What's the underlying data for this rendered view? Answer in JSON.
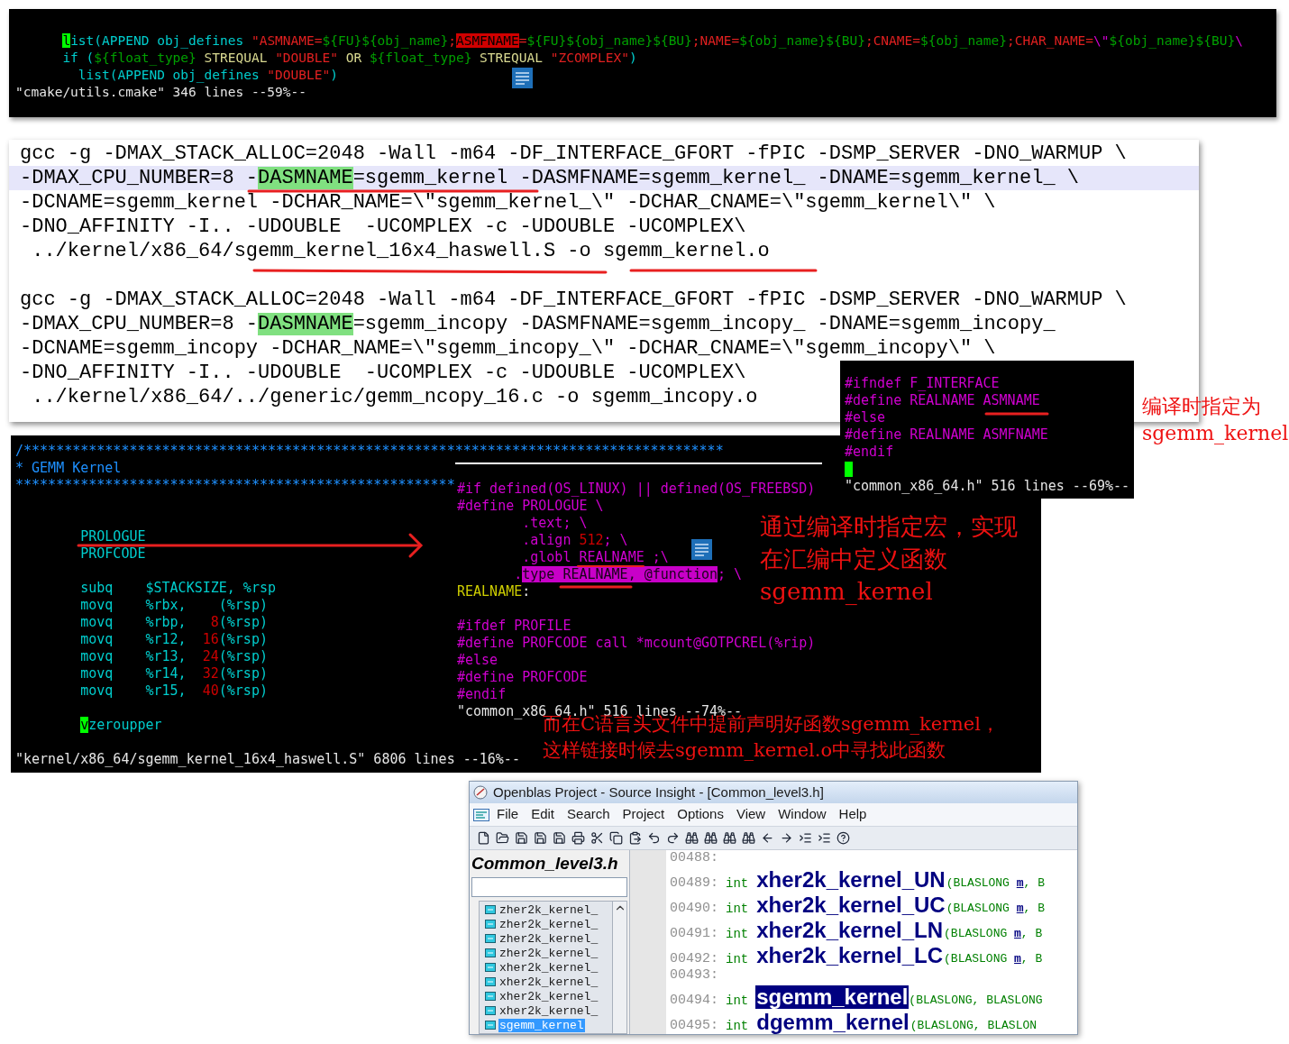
{
  "top_terminal": {
    "lines": [
      [
        {
          "text": "      l",
          "kind": "cursor"
        },
        {
          "text": "ist(APPEND obj_defines ",
          "kind": "keyword"
        },
        {
          "text": "\"ASMNAME=",
          "kind": "string"
        },
        {
          "text": "${FU}${obj_name}",
          "kind": "var"
        },
        {
          "text": ";",
          "kind": "string"
        },
        {
          "text": "ASMFNAME",
          "kind": "search"
        },
        {
          "text": "=",
          "kind": "string"
        },
        {
          "text": "${FU}${obj_name}${BU}",
          "kind": "var"
        },
        {
          "text": ";NAME=",
          "kind": "string"
        },
        {
          "text": "${obj_name}${BU}",
          "kind": "var"
        },
        {
          "text": ";CNAME=",
          "kind": "string"
        },
        {
          "text": "${obj_name}",
          "kind": "var"
        },
        {
          "text": ";CHAR_NAME=",
          "kind": "string"
        },
        {
          "text": "\\\"",
          "kind": "preproc"
        },
        {
          "text": "${obj_name}${BU}",
          "kind": "var"
        },
        {
          "text": "\\",
          "kind": "preproc"
        }
      ],
      [
        {
          "text": "      if (",
          "kind": "keyword"
        },
        {
          "text": "${float_type}",
          "kind": "var"
        },
        {
          "text": " STREQUAL ",
          "kind": "label"
        },
        {
          "text": "\"DOUBLE\"",
          "kind": "string"
        },
        {
          "text": " OR ",
          "kind": "label"
        },
        {
          "text": "${float_type}",
          "kind": "var"
        },
        {
          "text": " STREQUAL ",
          "kind": "label"
        },
        {
          "text": "\"ZCOMPLEX\"",
          "kind": "string"
        },
        {
          "text": ")",
          "kind": "keyword"
        }
      ],
      [
        {
          "text": "        list(APPEND obj_defines ",
          "kind": "keyword"
        },
        {
          "text": "\"DOUBLE\"",
          "kind": "string"
        },
        {
          "text": ")",
          "kind": "keyword"
        }
      ]
    ],
    "status": "\"cmake/utils.cmake\" 346 lines --59%--"
  },
  "build_log": {
    "commands": [
      {
        "lines": [
          {
            "current": false,
            "segments": [
              {
                "text": "gcc -g -DMAX_STACK_ALLOC=2048 -Wall -m64 -DF_INTERFACE_GFORT -fPIC -DSMP_SERVER -DNO_WARMUP \\",
                "kind": "text"
              }
            ]
          },
          {
            "current": true,
            "segments": [
              {
                "text": "-DMAX_CPU_NUMBER=8 -",
                "kind": "text"
              },
              {
                "text": "DASMNAME",
                "kind": "match"
              },
              {
                "text": "=sgemm_kernel -DASMFNAME=sgemm_kernel_ -DNAME=sgemm_kernel_ \\",
                "kind": "text"
              }
            ]
          },
          {
            "current": false,
            "segments": [
              {
                "text": "-DCNAME=sgemm_kernel -DCHAR_NAME=\\\"sgemm_kernel_\\\" -DCHAR_CNAME=\\\"sgemm_kernel\\\" \\",
                "kind": "text"
              }
            ]
          },
          {
            "current": false,
            "segments": [
              {
                "text": "-DNO_AFFINITY -I.. -UDOUBLE  -UCOMPLEX -c -UDOUBLE -UCOMPLEX\\",
                "kind": "text"
              }
            ]
          },
          {
            "current": false,
            "segments": [
              {
                "text": " ../kernel/x86_64/sgemm_kernel_16x4_haswell.S -o sgemm_kernel.o",
                "kind": "text"
              }
            ]
          }
        ]
      },
      {
        "lines": [
          {
            "current": false,
            "segments": [
              {
                "text": "gcc -g -DMAX_STACK_ALLOC=2048 -Wall -m64 -DF_INTERFACE_GFORT -fPIC -DSMP_SERVER -DNO_WARMUP \\",
                "kind": "text"
              }
            ]
          },
          {
            "current": false,
            "segments": [
              {
                "text": "-DMAX_CPU_NUMBER=8 -",
                "kind": "text"
              },
              {
                "text": "DASMNAME",
                "kind": "match"
              },
              {
                "text": "=sgemm_incopy -DASMFNAME=sgemm_incopy_ -DNAME=sgemm_incopy_",
                "kind": "text"
              }
            ]
          },
          {
            "current": false,
            "segments": [
              {
                "text": "-DCNAME=sgemm_incopy -DCHAR_NAME=\\\"sgemm_incopy_\\\" -DCHAR_CNAME=\\\"sgemm_incopy\\\" \\",
                "kind": "text"
              }
            ]
          },
          {
            "current": false,
            "segments": [
              {
                "text": "-DNO_AFFINITY -I.. -UDOUBLE  -UCOMPLEX -c -UDOUBLE -UCOMPLEX\\",
                "kind": "text"
              }
            ]
          },
          {
            "current": false,
            "segments": [
              {
                "text": " ../kernel/x86_64/../generic/gemm_ncopy_16.c -o sgemm_incopy.o",
                "kind": "text"
              }
            ]
          }
        ]
      }
    ]
  },
  "asm_terminal": {
    "blocks": [
      [
        [
          {
            "text": "/**************************************************************************************",
            "kind": "comment"
          }
        ],
        [
          {
            "text": "* GEMM Kernel",
            "kind": "comment"
          }
        ],
        [
          {
            "text": "******************************************************",
            "kind": "comment"
          }
        ]
      ],
      [
        [
          {
            "text": "        PROLOGUE",
            "kind": "keyword"
          }
        ],
        [
          {
            "text": "        PROFCODE",
            "kind": "keyword"
          }
        ]
      ],
      [
        [
          {
            "text": "        subq    $STACKSIZE, %rsp",
            "kind": "keyword"
          }
        ],
        [
          {
            "text": "        movq    %rbx,    (%rsp)",
            "kind": "keyword"
          }
        ],
        [
          {
            "text": "        movq    %rbp,   ",
            "kind": "keyword"
          },
          {
            "text": "8",
            "kind": "number"
          },
          {
            "text": "(%rsp)",
            "kind": "keyword"
          }
        ],
        [
          {
            "text": "        movq    %r12,  ",
            "kind": "keyword"
          },
          {
            "text": "16",
            "kind": "number"
          },
          {
            "text": "(%rsp)",
            "kind": "keyword"
          }
        ],
        [
          {
            "text": "        movq    %r13,  ",
            "kind": "keyword"
          },
          {
            "text": "24",
            "kind": "number"
          },
          {
            "text": "(%rsp)",
            "kind": "keyword"
          }
        ],
        [
          {
            "text": "        movq    %r14,  ",
            "kind": "keyword"
          },
          {
            "text": "32",
            "kind": "number"
          },
          {
            "text": "(%rsp)",
            "kind": "keyword"
          }
        ],
        [
          {
            "text": "        movq    %r15,  ",
            "kind": "keyword"
          },
          {
            "text": "40",
            "kind": "number"
          },
          {
            "text": "(%rsp)",
            "kind": "keyword"
          }
        ]
      ],
      [
        [
          {
            "text": "        v",
            "kind": "cursor"
          },
          {
            "text": "zeroupper",
            "kind": "keyword"
          }
        ]
      ]
    ],
    "status": "\"kernel/x86_64/sgemm_kernel_16x4_haswell.S\" 6806 lines --16%--"
  },
  "macro_terminal": {
    "blocks": [
      [
        [
          {
            "text": "#if defined(OS_LINUX) || defined(OS_FREEBSD)",
            "kind": "preproc"
          }
        ],
        [
          {
            "text": "#define PROLOGUE \\",
            "kind": "preproc"
          }
        ],
        [
          {
            "text": "        .text; \\",
            "kind": "preproc"
          }
        ],
        [
          {
            "text": "        .align ",
            "kind": "preproc"
          },
          {
            "text": "512",
            "kind": "number"
          },
          {
            "text": "; \\",
            "kind": "preproc"
          }
        ],
        [
          {
            "text": "        .globl REALNAME ;\\",
            "kind": "preproc"
          }
        ],
        [
          {
            "text": "       .",
            "kind": "preproc"
          },
          {
            "text": "type REALNAME, @function",
            "kind": "marked"
          },
          {
            "text": "; \\",
            "kind": "preproc"
          }
        ],
        [
          {
            "text": "REALNAME",
            "kind": "ident"
          },
          {
            "text": ":",
            "kind": "plain"
          }
        ]
      ],
      [
        [
          {
            "text": "#ifdef PROFILE",
            "kind": "preproc"
          }
        ],
        [
          {
            "text": "#define PROFCODE call *mcount@GOTPCREL(%rip)",
            "kind": "preproc"
          }
        ],
        [
          {
            "text": "#else",
            "kind": "preproc"
          }
        ],
        [
          {
            "text": "#define PROFCODE",
            "kind": "preproc"
          }
        ],
        [
          {
            "text": "#endif",
            "kind": "preproc"
          }
        ]
      ]
    ],
    "status": "\"common_x86_64.h\" 516 lines --74%--"
  },
  "header_terminal": {
    "lines": [
      [
        {
          "text": "#ifndef F_INTERFACE",
          "kind": "preproc"
        }
      ],
      [
        {
          "text": "#define REALNAME ASMNAME",
          "kind": "preproc"
        }
      ],
      [
        {
          "text": "#else",
          "kind": "preproc"
        }
      ],
      [
        {
          "text": "#define REALNAME ASMFNAME",
          "kind": "preproc"
        }
      ],
      [
        {
          "text": "#endif",
          "kind": "preproc"
        }
      ],
      [
        {
          "kind": "cursor"
        }
      ]
    ],
    "status": "\"common_x86_64.h\" 516 lines --69%--"
  },
  "annotations": [
    {
      "lines": [
        "编译时指定为",
        "sgemm_kernel"
      ]
    },
    {
      "lines": [
        "通过编译时指定宏，实现",
        "在汇编中定义函数",
        "sgemm_kernel"
      ]
    },
    {
      "lines": [
        "而在C语言头文件中提前声明好函数sgemm_kernel，",
        "这样链接时候去sgemm_kernel.o中寻找此函数"
      ]
    }
  ],
  "source_insight": {
    "title": "Openblas Project - Source Insight - [Common_level3.h]",
    "menu": [
      "File",
      "Edit",
      "Search",
      "Project",
      "Options",
      "View",
      "Window",
      "Help"
    ],
    "file_title": "Common_level3.h",
    "symbols": [
      {
        "label": "zher2k_kernel_",
        "selected": false
      },
      {
        "label": "zher2k_kernel_",
        "selected": false
      },
      {
        "label": "zher2k_kernel_",
        "selected": false
      },
      {
        "label": "zher2k_kernel_",
        "selected": false
      },
      {
        "label": "xher2k_kernel_",
        "selected": false
      },
      {
        "label": "xher2k_kernel_",
        "selected": false
      },
      {
        "label": "xher2k_kernel_",
        "selected": false
      },
      {
        "label": "xher2k_kernel_",
        "selected": false
      },
      {
        "label": "sgemm_kernel",
        "selected": true
      }
    ],
    "code": [
      {
        "number": "00488:",
        "selected": false
      },
      {
        "number": "00489:",
        "type": "int",
        "name": "xher2k_kernel_UN",
        "selected": false,
        "tail": [
          {
            "text": "(BLASLONG ",
            "kind": "param"
          },
          {
            "text": "m",
            "kind": "arg"
          },
          {
            "text": ", B",
            "kind": "param"
          }
        ]
      },
      {
        "number": "00490:",
        "type": "int",
        "name": "xher2k_kernel_UC",
        "selected": false,
        "tail": [
          {
            "text": "(BLASLONG ",
            "kind": "param"
          },
          {
            "text": "m",
            "kind": "arg"
          },
          {
            "text": ", B",
            "kind": "param"
          }
        ]
      },
      {
        "number": "00491:",
        "type": "int",
        "name": "xher2k_kernel_LN",
        "selected": false,
        "tail": [
          {
            "text": "(BLASLONG ",
            "kind": "param"
          },
          {
            "text": "m",
            "kind": "arg"
          },
          {
            "text": ", B",
            "kind": "param"
          }
        ]
      },
      {
        "number": "00492:",
        "type": "int",
        "name": "xher2k_kernel_LC",
        "selected": false,
        "tail": [
          {
            "text": "(BLASLONG ",
            "kind": "param"
          },
          {
            "text": "m",
            "kind": "arg"
          },
          {
            "text": ", B",
            "kind": "param"
          }
        ]
      },
      {
        "number": "00493:",
        "selected": false
      },
      {
        "number": "00494:",
        "type": "int",
        "name": "sgemm_kernel",
        "selected": true,
        "tail": [
          {
            "text": "(BLASLONG, BLASLONG",
            "kind": "param"
          }
        ]
      },
      {
        "number": "00495:",
        "type": "int",
        "name": "dgemm_kernel",
        "selected": false,
        "tail": [
          {
            "text": "(BLASLONG, BLASLON",
            "kind": "param"
          }
        ]
      }
    ]
  }
}
